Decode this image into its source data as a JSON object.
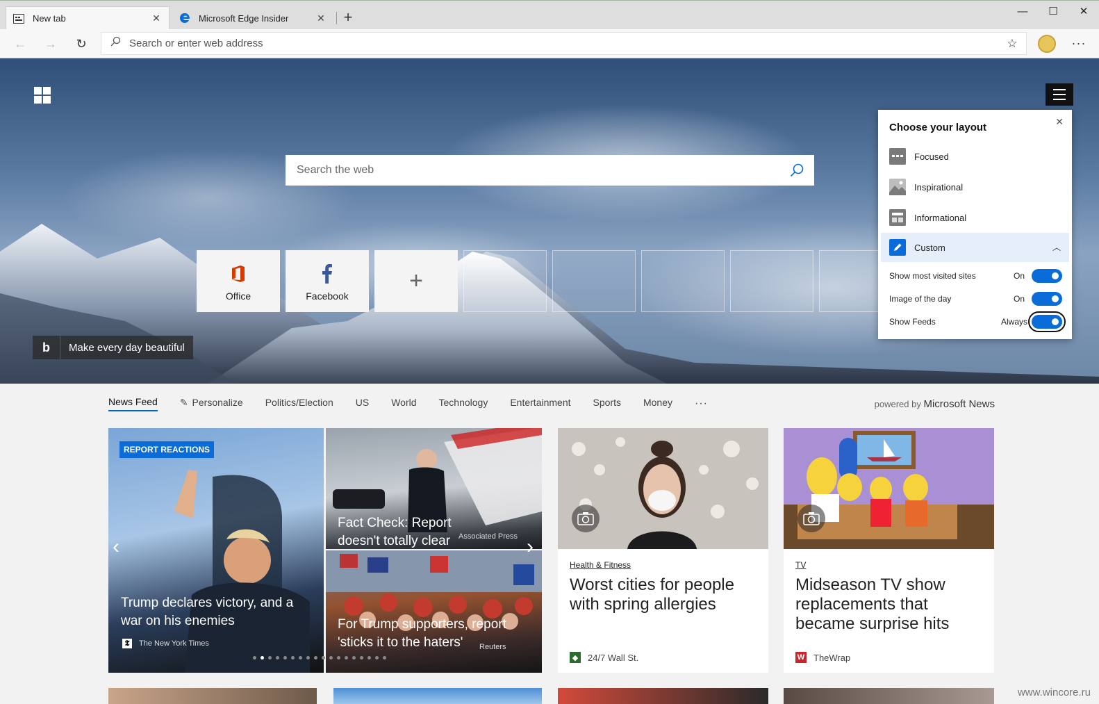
{
  "browser": {
    "tabs": [
      {
        "title": "New tab",
        "icon": "new-tab-page-icon",
        "active": true
      },
      {
        "title": "Microsoft Edge Insider",
        "icon": "edge-logo-icon",
        "active": false
      }
    ],
    "new_tab_label": "+",
    "address_placeholder": "Search or enter web address"
  },
  "hero": {
    "search_placeholder": "Search the web",
    "bing_caption": "Make every day beautiful",
    "tiles": [
      {
        "label": "Office",
        "icon": "office-icon",
        "color": "#d83b01"
      },
      {
        "label": "Facebook",
        "icon": "facebook-icon",
        "color": "#3b5998"
      }
    ]
  },
  "layout_panel": {
    "title": "Choose your layout",
    "options": [
      "Focused",
      "Inspirational",
      "Informational",
      "Custom"
    ],
    "selected": "Custom",
    "toggles": [
      {
        "label": "Show most visited sites",
        "state": "On"
      },
      {
        "label": "Image of the day",
        "state": "On"
      },
      {
        "label": "Show Feeds",
        "state": "Always"
      }
    ],
    "accent": "#0a6cd9"
  },
  "feed": {
    "tabs": [
      "News Feed",
      "Personalize",
      "Politics/Election",
      "US",
      "World",
      "Technology",
      "Entertainment",
      "Sports",
      "Money"
    ],
    "more": "···",
    "powered_by": "powered by",
    "provider": "Microsoft News",
    "carousel": {
      "badge": "REPORT REACTIONS",
      "main": {
        "title": "Trump declares victory, and a war on his enemies",
        "source": "The New York Times"
      },
      "side": [
        {
          "title": "Fact Check: Report doesn't totally clear Trump",
          "source": "Associated Press"
        },
        {
          "title": "For Trump supporters, report 'sticks it to the haters'",
          "source": "Reuters"
        }
      ]
    },
    "cards": [
      {
        "category": "Health & Fitness",
        "title": "Worst cities for people with spring allergies",
        "source": "24/7 Wall St."
      },
      {
        "category": "TV",
        "title": "Midseason TV show replacements that became surprise hits",
        "source": "TheWrap"
      }
    ]
  },
  "watermark": "www.wincore.ru"
}
